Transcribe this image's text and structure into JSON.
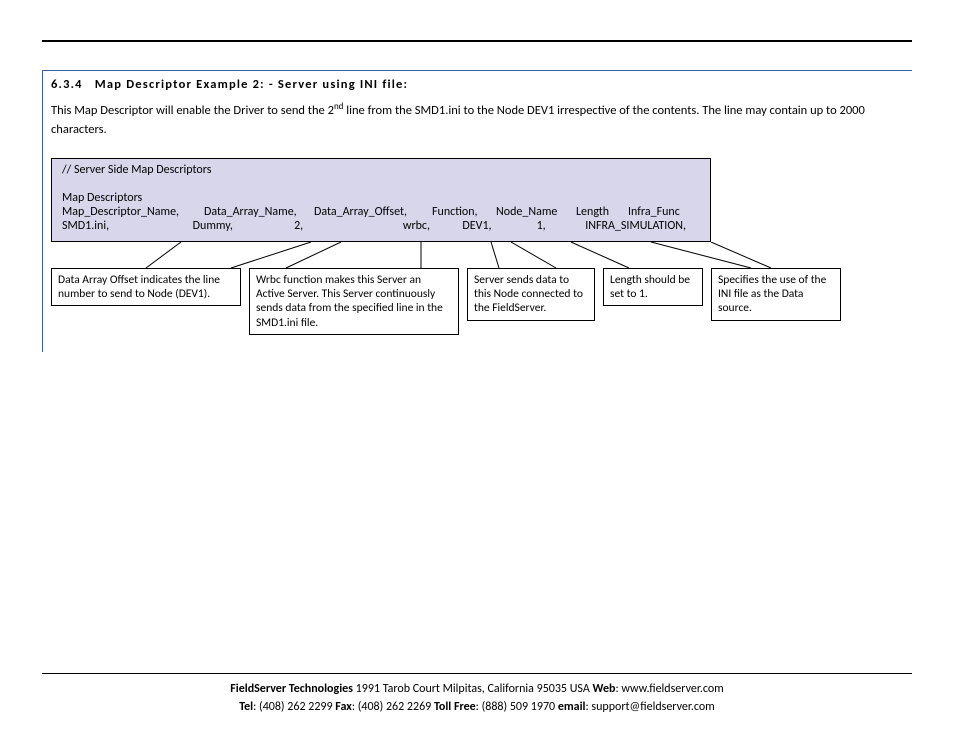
{
  "section": {
    "number": "6.3.4",
    "title": "Map Descriptor Example 2: - Server using INI file:"
  },
  "body": {
    "part1": "This Map Descriptor will enable the Driver to send the 2",
    "sup": "nd",
    "part2": " line from the SMD1.ini to the Node DEV1 irrespective of the contents. The line may contain up to 2000 characters."
  },
  "table": {
    "title": "//    Server Side Map Descriptors",
    "subtitle": "Map Descriptors",
    "headers": {
      "c1": "Map_Descriptor_Name,",
      "c2": "Data_Array_Name,",
      "c3": "Data_Array_Offset,",
      "c4": "Function,",
      "c5": "Node_Name",
      "c6": "Length",
      "c7": "Infra_Func"
    },
    "values": {
      "c1": "SMD1.ini,",
      "c2": "Dummy,",
      "c3": "2,",
      "c4": "wrbc,",
      "c5": "DEV1,",
      "c6": "1,",
      "c7": "INFRA_SIMULATION,"
    }
  },
  "callouts": {
    "offset": "Data Array Offset indicates the line number to send to Node (DEV1).",
    "wrbc": "Wrbc function makes this Server an Active Server. This Server continuously sends data from the specified line in the SMD1.ini file.",
    "node": "Server sends data to this Node connected to the FieldServer.",
    "length": "Length should be set to 1.",
    "infra": "Specifies the use of the INI file as the Data source."
  },
  "footer": {
    "company": "FieldServer Technologies",
    "addr": " 1991 Tarob Court Milpitas, California 95035 USA   ",
    "web_l": "Web",
    "web_v": ": www.fieldserver.com",
    "tel_l": "Tel",
    "tel_v": ": (408) 262 2299   ",
    "fax_l": "Fax",
    "fax_v": ": (408) 262 2269   ",
    "toll_l": "Toll Free",
    "toll_v": ": (888) 509 1970   ",
    "email_l": "email",
    "email_v": ": support@fieldserver.com"
  }
}
